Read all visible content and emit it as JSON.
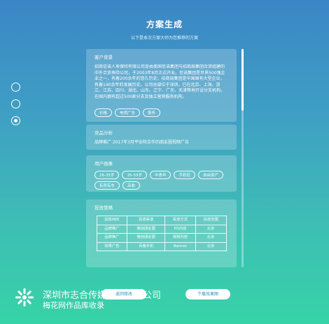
{
  "header": {
    "title": "方案生成",
    "subtitle": "以下是本次方案大师为您推荐的方案"
  },
  "client_info": {
    "label": "客户背景",
    "text": "招商信诺人寿保险有限公司是由美国信诺集团与招商局集团合资组建的中外合资寿险公司，于2003年8月正式开业。信诺集团是世界500强企业之一，有着200余年的悠久历史；招商局集团是中国国有大型企业，有着140余年的发展历史。公司总部位于深圳，已在北京、上海、浙江、江苏、四川、湖北、山东、辽宁、广东、天津等地开设分支机构，在国内拥有超过500家分支及独立营销服务机构。",
    "tags": [
      "价格",
      "电视广告",
      "服务"
    ]
  },
  "competitor": {
    "label": "竞品分析",
    "text": "品牌推广  2017年3月平安险合作的朋友圈视频广告"
  },
  "user_profile": {
    "label": "用户画像",
    "tags": [
      "26-35岁",
      "35-55岁",
      "中青年",
      "手机控",
      "自由资产",
      "有房有车",
      "高收"
    ]
  },
  "channels": {
    "label": "投放策略",
    "headers": [
      "投放目的",
      "投放渠道",
      "投放方式",
      "投放范围"
    ],
    "rows": [
      [
        "品牌推广",
        "微信朋友圈",
        "H5内容",
        "北京"
      ],
      [
        "品牌推广",
        "微信朋友圈",
        "视频内容",
        "北京"
      ],
      [
        "效果广告",
        "百度手机",
        "Banner",
        "北京"
      ]
    ]
  },
  "footer": {
    "company": "深圳市志合传媒广告有限公司",
    "watermark": "梅花网作品库收录",
    "btn_reset": "返回修改",
    "btn_download": "下载效果图"
  },
  "colors": {
    "bg_top": "#3b86c6",
    "bg_bottom": "#36d3a7"
  }
}
